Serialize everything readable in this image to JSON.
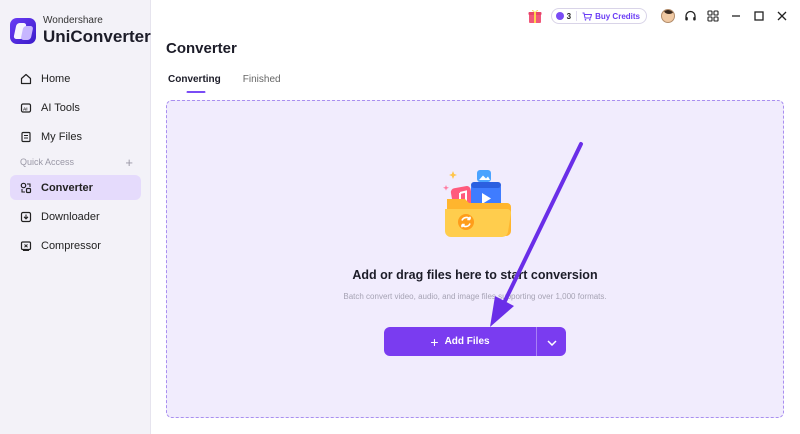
{
  "app": {
    "brand": "Wondershare",
    "product": "UniConverter"
  },
  "sidebar": {
    "items": [
      {
        "label": "Home",
        "icon": "home-icon"
      },
      {
        "label": "AI Tools",
        "icon": "ai-tools-icon"
      },
      {
        "label": "My Files",
        "icon": "my-files-icon"
      }
    ],
    "quick_access_label": "Quick Access",
    "quick_items": [
      {
        "label": "Converter",
        "icon": "converter-icon",
        "active": true
      },
      {
        "label": "Downloader",
        "icon": "downloader-icon"
      },
      {
        "label": "Compressor",
        "icon": "compressor-icon"
      }
    ]
  },
  "topbar": {
    "credits": "3",
    "buy_label": "Buy Credits",
    "icons": [
      "gift-icon",
      "coin-icon",
      "cart-icon",
      "avatar",
      "headset-icon",
      "grid-menu-icon",
      "minimize-icon",
      "maximize-icon",
      "close-icon"
    ]
  },
  "main": {
    "title": "Converter",
    "tabs": [
      {
        "label": "Converting",
        "active": true
      },
      {
        "label": "Finished",
        "active": false
      }
    ],
    "dropzone": {
      "title": "Add or drag files here to start conversion",
      "subtitle": "Batch convert video, audio, and image files supporting over 1,000 formats.",
      "add_button": "Add Files"
    }
  },
  "colors": {
    "accent": "#7a3cf0",
    "dropzone_bg": "#f1ecfd",
    "sidebar_active": "#e5dbfc",
    "annotation_arrow": "#6a2ee8"
  }
}
